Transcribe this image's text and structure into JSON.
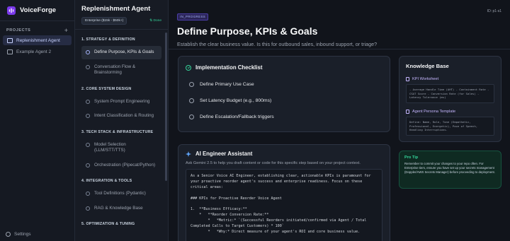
{
  "app": {
    "name": "VoiceForge"
  },
  "sidebar": {
    "projects_label": "PROJECTS",
    "add_icon": "plus-icon",
    "projects": [
      {
        "label": "Replenishment Agent",
        "active": true
      },
      {
        "label": "Example Agent 2",
        "active": false
      }
    ],
    "settings_label": "Settings"
  },
  "steps_panel": {
    "agent_title": "Replenishment Agent",
    "tier": "Enterprise ($15k - $50k+)",
    "sync_status": "Done",
    "sections": [
      {
        "title": "1. STRATEGY & DEFINITION",
        "steps": [
          {
            "label": "Define Purpose, KPIs & Goals",
            "active": true
          },
          {
            "label": "Conversation Flow & Brainstorming",
            "active": false
          }
        ]
      },
      {
        "title": "2. CORE SYSTEM DESIGN",
        "steps": [
          {
            "label": "System Prompt Engineering",
            "active": false
          },
          {
            "label": "Intent Classification & Routing",
            "active": false
          }
        ]
      },
      {
        "title": "3. TECH STACK & INFRASTRUCTURE",
        "steps": [
          {
            "label": "Model Selection (LLM/STT/TTS)",
            "active": false
          },
          {
            "label": "Orchestration (Pipecat/Python)",
            "active": false
          }
        ]
      },
      {
        "title": "4. INTEGRATION & TOOLS",
        "steps": [
          {
            "label": "Tool Definitions (Pydantic)",
            "active": false
          },
          {
            "label": "RAG & Knowledge Base",
            "active": false
          }
        ]
      },
      {
        "title": "5. OPTIMIZATION & TUNING",
        "steps": []
      }
    ]
  },
  "main": {
    "status_badge": "IN_PROGRESS",
    "step_id": "ID: p1-s1",
    "title": "Define Purpose, KPIs & Goals",
    "subtitle": "Establish the clear business value. Is this for outbound sales, inbound support, or triage?",
    "checklist": {
      "title": "Implementation Checklist",
      "tasks": [
        "Define Primary Use Case",
        "Set Latency Budget (e.g., 800ms)",
        "Define Escalation/Fallback triggers"
      ]
    },
    "knowledge_base": {
      "title": "Knowledge Base",
      "items": [
        {
          "title": "KPI Worksheet",
          "content": "- Average Handle Time (AHT) - Containment Rate - CSAT Score - Conversion Rate (for Sales) - Latency Tolerance (ms)"
        },
        {
          "title": "Agent Persona Template",
          "content": "Define: Name, Role, Tone (Empathetic, Professional, Energetic), Pace of Speech, Handling Interruptions."
        }
      ]
    },
    "protip": {
      "title": "Pro Tip",
      "text": "Remember to commit your changes to your repo often. For Enterprise tiers, ensure you have set up your secrets management (Doppler/AWS Secrets Manager) before proceeding to deployment."
    },
    "assistant": {
      "title": "AI Engineer Assistant",
      "subtitle": "Ask Gemini 2.5 to help you draft content or code for this specific step based on your project context.",
      "output": "As a Senior Voice AI Engineer, establishing clear, actionable KPIs is paramount for your proactive reorder agent's success and enterprise readiness. Focus on these critical areas:\n\n### KPIs for Proactive Reorder Voice Agent\n\n1.  **Business Efficacy:**\n    *   **Reorder Conversion Rate:**\n        *   *Metric:* `(Successful Reorders initiated/confirmed via Agent / Total Completed Calls to Target Customers) * 100`\n        *   *Why:* Direct measure of your agent's ROI and core business value."
    }
  },
  "colors": {
    "accent": "#7c3aed",
    "active_bg": "#262c44",
    "success": "#34d399",
    "link": "#c4b5fd"
  }
}
